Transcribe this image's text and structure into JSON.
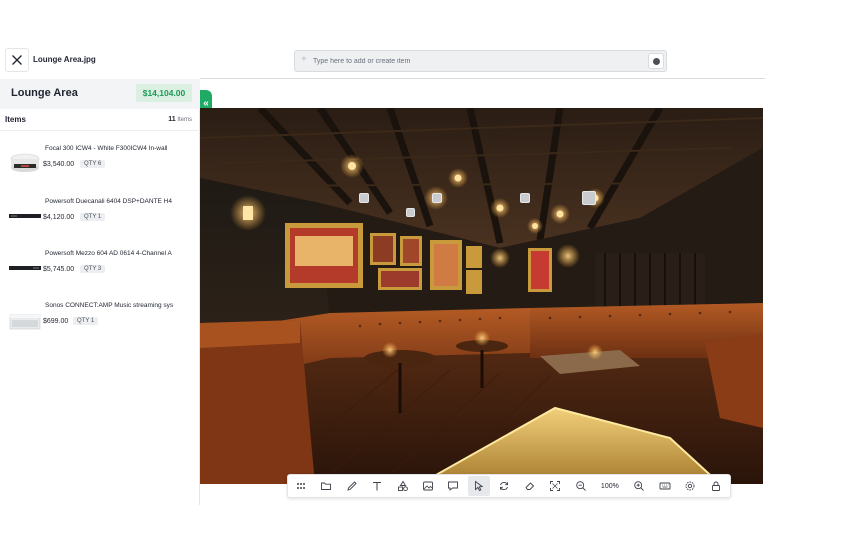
{
  "header": {
    "file_name": "Lounge Area.jpg",
    "add_placeholder": "Type here to add or create item"
  },
  "sidebar": {
    "room_name": "Lounge Area",
    "room_total": "$14,104.00",
    "items_label": "Items",
    "items_count": "11",
    "items_count_suffix": "Items",
    "products": [
      {
        "name": "Focal 300 ICW4 - White F300ICW4 In-wall",
        "price": "$3,540.00",
        "qty": "QTY 6",
        "thumb": "ceiling-speaker"
      },
      {
        "name": "Powersoft Duecanali 6404 DSP+DANTE H4",
        "price": "$4,120.00",
        "qty": "QTY 1",
        "thumb": "amplifier-rack"
      },
      {
        "name": "Powersoft Mezzo 604 AD 0614 4-Channel A",
        "price": "$5,745.00",
        "qty": "QTY 3",
        "thumb": "amplifier-rack"
      },
      {
        "name": "Sonos CONNECT:AMP Music streaming sys",
        "price": "$699.00",
        "qty": "QTY 1",
        "thumb": "sonos-amp"
      }
    ]
  },
  "canvas": {
    "photo_subject": "lounge-room-photo",
    "marker_count": 5
  },
  "toolbar": {
    "zoom": "100%",
    "tools": [
      "grid-icon",
      "folder-icon",
      "pencil-icon",
      "text-icon",
      "shapes-icon",
      "image-icon",
      "comment-icon",
      "select-cursor-icon",
      "refresh-icon",
      "eraser-icon",
      "fit-screen-icon",
      "zoom-out-icon",
      "zoom-in-icon",
      "keyboard-icon",
      "settings-icon",
      "lock-icon"
    ],
    "active_tool": "select-cursor-icon"
  },
  "colors": {
    "accent_green": "#1faa65",
    "total_text": "#1b9a55",
    "total_bg": "#dcefe3"
  }
}
